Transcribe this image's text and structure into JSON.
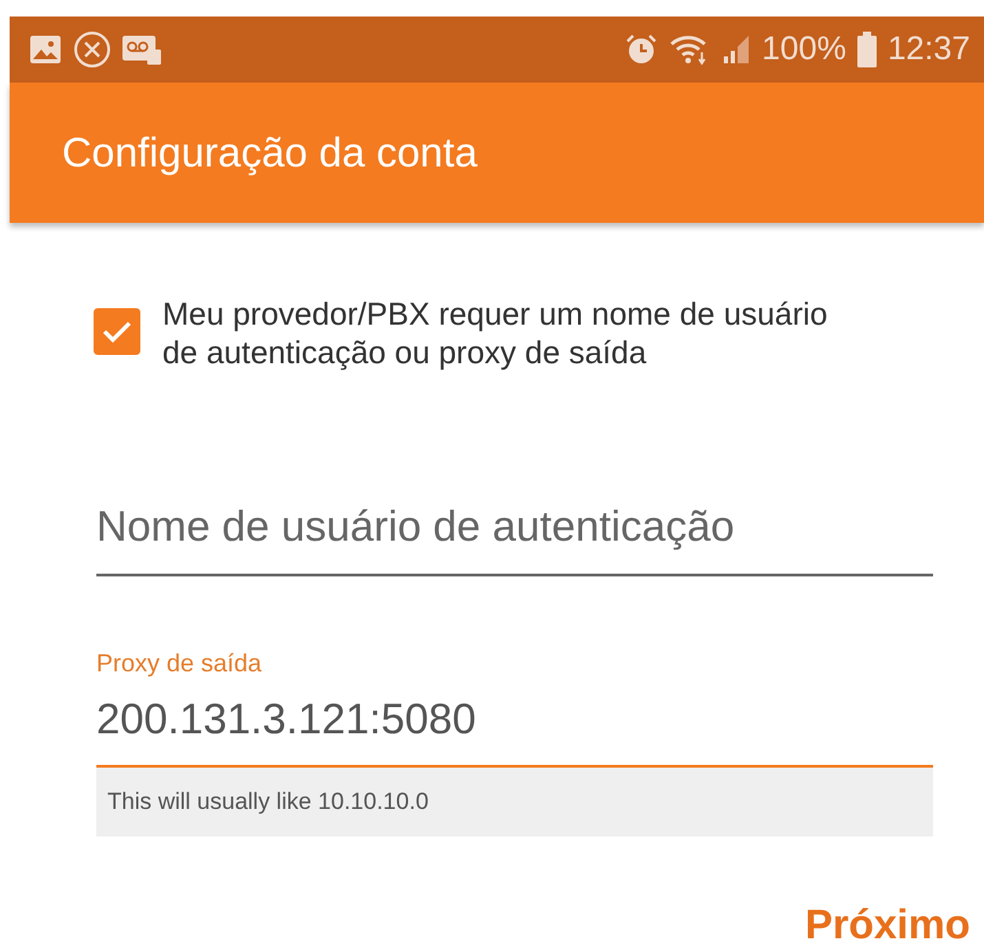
{
  "status_bar": {
    "battery": "100%",
    "time": "12:37"
  },
  "app_bar": {
    "title": "Configuração da conta"
  },
  "checkbox": {
    "label": "Meu provedor/PBX requer um nome de usuário de autenticação ou proxy de saída",
    "checked": true
  },
  "fields": [
    {
      "placeholder": "Nome de usuário de autenticação",
      "focused": false
    },
    {
      "label": "Proxy de saída",
      "value": "200.131.3.121:5080",
      "focused": true,
      "hint": "This will usually like 10.10.10.0"
    }
  ],
  "buttons": [
    "Próximo"
  ]
}
